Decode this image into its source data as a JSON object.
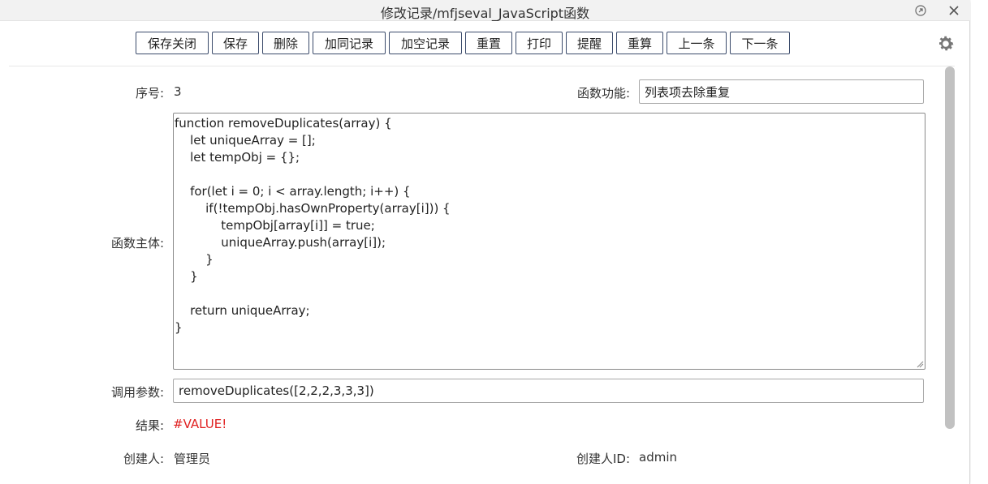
{
  "window": {
    "title": "修改记录/mfjseval_JavaScript函数",
    "restore_icon": "restore-icon",
    "close_icon": "close-icon"
  },
  "toolbar": {
    "buttons": [
      {
        "label": "保存关闭"
      },
      {
        "label": "保存"
      },
      {
        "label": "删除"
      },
      {
        "label": "加同记录"
      },
      {
        "label": "加空记录"
      },
      {
        "label": "重置"
      },
      {
        "label": "打印"
      },
      {
        "label": "提醒"
      },
      {
        "label": "重算"
      },
      {
        "label": "上一条"
      },
      {
        "label": "下一条"
      }
    ],
    "settings_icon": "gear-icon"
  },
  "form": {
    "seq_label": "序号:",
    "seq_value": "3",
    "func_feature_label": "函数功能:",
    "func_feature_value": "列表项去除重复",
    "func_body_label": "函数主体:",
    "func_body_value": "function removeDuplicates(array) {\n    let uniqueArray = [];\n    let tempObj = {};\n\n    for(let i = 0; i < array.length; i++) {\n        if(!tempObj.hasOwnProperty(array[i])) {\n            tempObj[array[i]] = true;\n            uniqueArray.push(array[i]);\n        }\n    }\n\n    return uniqueArray;\n}",
    "call_params_label": "调用参数:",
    "call_params_value": "removeDuplicates([2,2,2,3,3,3])",
    "result_label": "结果:",
    "result_value": "#VALUE!",
    "creator_label": "创建人:",
    "creator_value": "管理员",
    "creator_id_label": "创建人ID:",
    "creator_id_value": "admin"
  },
  "colors": {
    "error_text": "#e02020",
    "button_border": "#3b4b6b",
    "title_bar": "#f2f2f2"
  }
}
